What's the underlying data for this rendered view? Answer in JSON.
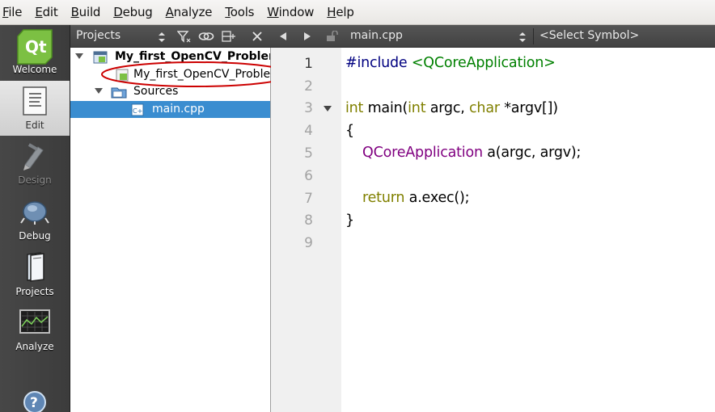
{
  "menubar": {
    "items": [
      {
        "underline": "F",
        "rest": "ile"
      },
      {
        "underline": "E",
        "rest": "dit"
      },
      {
        "underline": "B",
        "rest": "uild"
      },
      {
        "underline": "D",
        "rest": "ebug"
      },
      {
        "underline": "A",
        "rest": "nalyze"
      },
      {
        "underline": "T",
        "rest": "ools"
      },
      {
        "underline": "W",
        "rest": "indow"
      },
      {
        "underline": "H",
        "rest": "elp"
      }
    ]
  },
  "modes": {
    "welcome": "Welcome",
    "edit": "Edit",
    "design": "Design",
    "debug": "Debug",
    "projects": "Projects",
    "analyze": "Analyze"
  },
  "projects_pane": {
    "title": "Projects",
    "tree": {
      "project": "My_first_OpenCV_Problem",
      "pro_file": "My_first_OpenCV_Problem",
      "sources": "Sources",
      "main_file": "main.cpp"
    }
  },
  "editor": {
    "file": "main.cpp",
    "symbol": "<Select Symbol>",
    "line_numbers": [
      "1",
      "2",
      "3",
      "4",
      "5",
      "6",
      "7",
      "8",
      "9"
    ],
    "code": {
      "l1_directive": "#include ",
      "l1_header": "<QCoreApplication>",
      "l3_int1": "int",
      "l3_main": " main(",
      "l3_int2": "int",
      "l3_argc": " argc, ",
      "l3_char": "char",
      "l3_argv": " *argv[])",
      "l4": "{",
      "l5_type": "QCoreApplication",
      "l5_rest": " a(argc, argv);",
      "l7_return": "return",
      "l7_rest": " a.exec();",
      "l8": "}"
    }
  },
  "colors": {
    "selection": "#3a8dd0",
    "annotation_ellipse": "#cc0000",
    "keyword": "#808000",
    "type": "#800080",
    "string": "#008000"
  }
}
